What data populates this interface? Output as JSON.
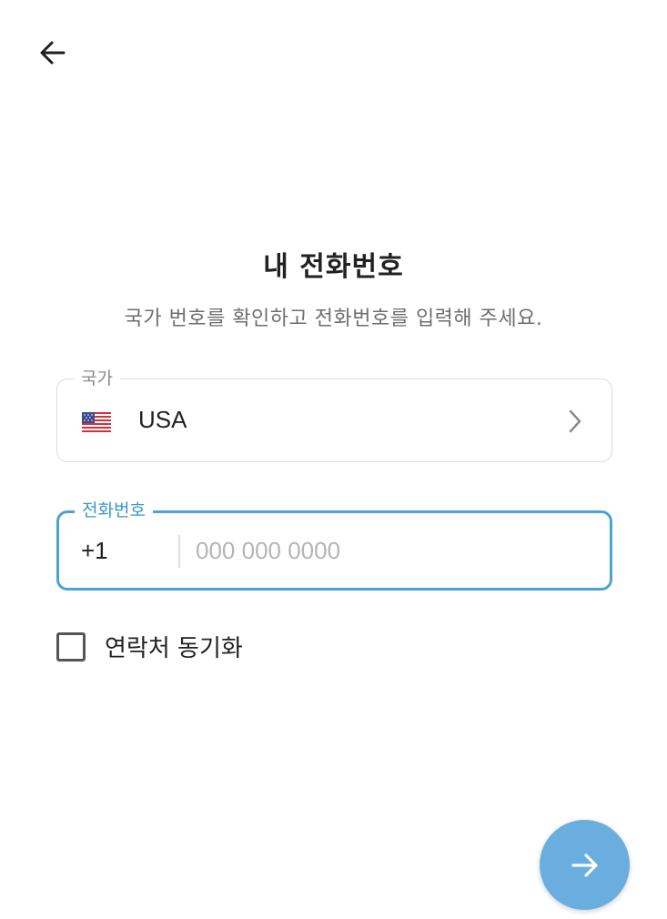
{
  "header": {
    "back_icon": "arrow-left-icon"
  },
  "content": {
    "title": "내 전화번호",
    "subtitle": "국가 번호를 확인하고 전화번호를 입력해 주세요."
  },
  "country_field": {
    "label": "국가",
    "flag_icon": "us-flag-icon",
    "value": "USA",
    "chevron_icon": "chevron-right-icon"
  },
  "phone_field": {
    "label": "전화번호",
    "dial_code": "+1",
    "value": "",
    "placeholder": "000 000 0000"
  },
  "contacts_sync": {
    "label": "연락처 동기화",
    "checked": false
  },
  "next_button": {
    "icon": "arrow-right-icon"
  },
  "colors": {
    "accent": "#4aa3d4",
    "fab": "#6aaee0",
    "border": "#dcdcdc",
    "muted_text": "#6e6e6e"
  }
}
